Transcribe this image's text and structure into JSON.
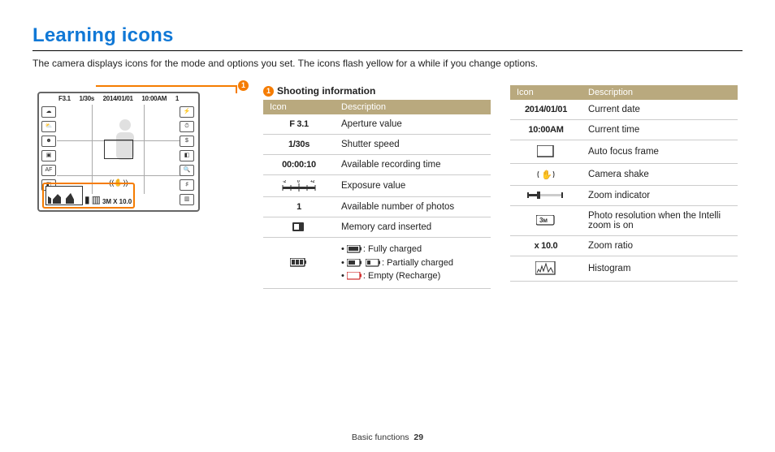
{
  "title": "Learning icons",
  "intro": "The camera displays icons for the mode and options you set. The icons flash yellow for a while if you change options.",
  "callout_number": "1",
  "section1_title": "Shooting information",
  "th_icon": "Icon",
  "th_desc": "Description",
  "screen": {
    "aperture": "F3.1",
    "shutter": "1/30s",
    "date": "2014/01/01",
    "time": "10:00AM",
    "count": "1",
    "zoom_pill": "3M",
    "zoom_ratio": "X 10.0"
  },
  "table1": [
    {
      "icon_text": "F 3.1",
      "desc": "Aperture value"
    },
    {
      "icon_text": "1/30s",
      "desc": "Shutter speed"
    },
    {
      "icon_text": "00:00:10",
      "desc": "Available recording time"
    },
    {
      "svg": "exposure",
      "desc": "Exposure value"
    },
    {
      "icon_text": "1",
      "desc": "Available number of photos"
    },
    {
      "svg": "card",
      "desc": "Memory card inserted"
    },
    {
      "svg": "battery",
      "desc_list": [
        {
          "svg": "batt-full",
          "label": ": Fully charged"
        },
        {
          "svg": "batt-part",
          "label": ": Partially charged"
        },
        {
          "svg": "batt-empty",
          "label": ": Empty (Recharge)"
        }
      ]
    }
  ],
  "table2": [
    {
      "icon_text": "2014/01/01",
      "desc": "Current date"
    },
    {
      "icon_text": "10:00AM",
      "desc": "Current time"
    },
    {
      "svg": "af",
      "desc": "Auto focus frame"
    },
    {
      "svg": "shake",
      "desc": "Camera shake"
    },
    {
      "svg": "zoom",
      "desc": "Zoom indicator"
    },
    {
      "svg": "res",
      "desc": "Photo resolution when the Intelli zoom is on"
    },
    {
      "icon_text": "x 10.0",
      "desc": "Zoom ratio"
    },
    {
      "svg": "hist",
      "desc": "Histogram"
    }
  ],
  "footer_section": "Basic functions",
  "footer_page": "29"
}
